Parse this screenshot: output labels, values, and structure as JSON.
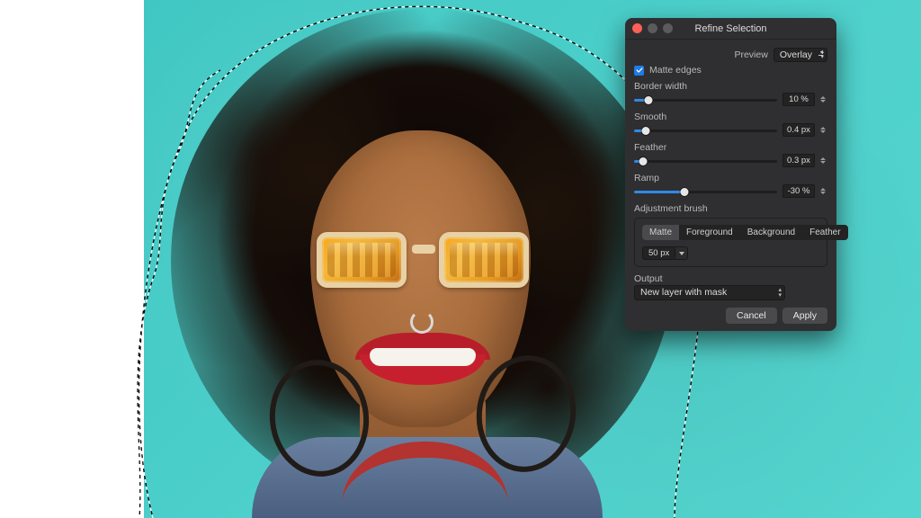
{
  "dialog": {
    "title": "Refine Selection",
    "preview_label": "Preview",
    "preview_value": "Overlay",
    "matte_edges_label": "Matte edges",
    "matte_edges_checked": true,
    "sliders": {
      "border_width": {
        "label": "Border width",
        "value": "10 %",
        "pct": 10
      },
      "smooth": {
        "label": "Smooth",
        "value": "0.4 px",
        "pct": 8
      },
      "feather": {
        "label": "Feather",
        "value": "0.3 px",
        "pct": 6
      },
      "ramp": {
        "label": "Ramp",
        "value": "-30 %",
        "pct": 35,
        "fill_from_center": true
      }
    },
    "adjustment_brush": {
      "label": "Adjustment brush",
      "tabs": [
        "Matte",
        "Foreground",
        "Background",
        "Feather"
      ],
      "active_tab": 0,
      "size": "50 px"
    },
    "output": {
      "label": "Output",
      "value": "New layer with mask"
    },
    "buttons": {
      "cancel": "Cancel",
      "apply": "Apply"
    }
  }
}
